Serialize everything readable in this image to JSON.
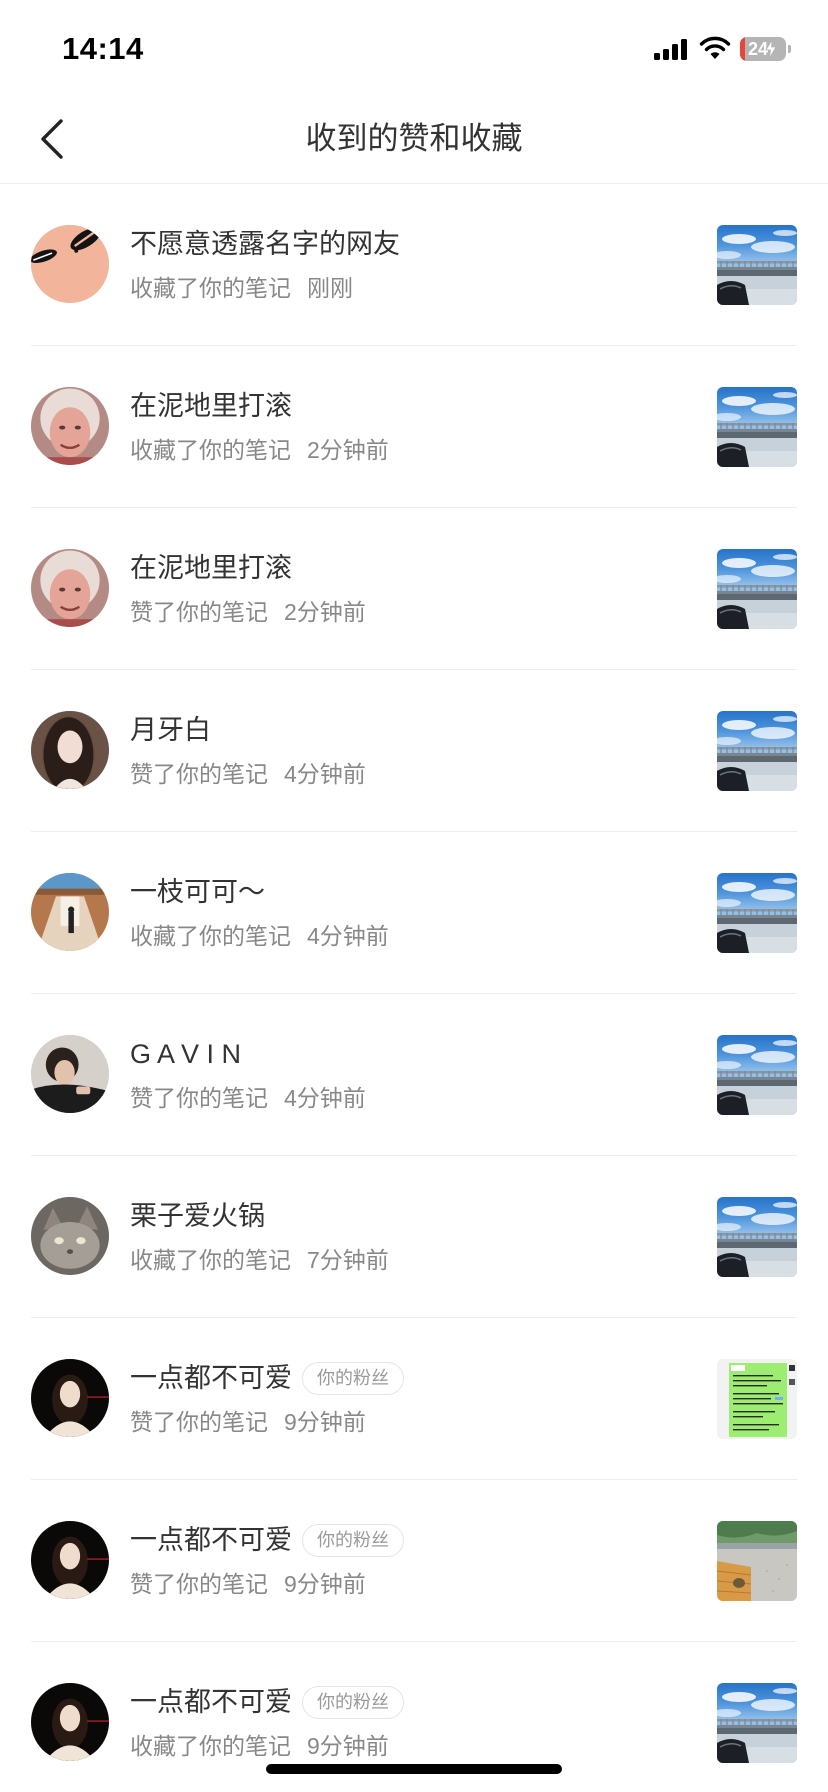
{
  "status_bar": {
    "time": "14:14",
    "battery": "24",
    "icons": [
      "cellular-signal-icon",
      "wifi-icon",
      "battery-icon",
      "charging-bolt-icon"
    ]
  },
  "header": {
    "title": "收到的赞和收藏",
    "back_icon": "chevron-left-icon"
  },
  "rows": [
    {
      "name": "不愿意透露名字的网友",
      "action": "收藏了你的笔记",
      "time": "刚刚",
      "avatar": "peach-abstract-avatar",
      "thumbnail": "bridge-sky-photo"
    },
    {
      "name": "在泥地里打滚",
      "action": "收藏了你的笔记",
      "time": "2分钟前",
      "avatar": "elderly-woman-avatar",
      "thumbnail": "bridge-sky-photo"
    },
    {
      "name": "在泥地里打滚",
      "action": "赞了你的笔记",
      "time": "2分钟前",
      "avatar": "elderly-woman-avatar",
      "thumbnail": "bridge-sky-photo"
    },
    {
      "name": "月牙白",
      "action": "赞了你的笔记",
      "time": "4分钟前",
      "avatar": "long-hair-girl-avatar",
      "thumbnail": "bridge-sky-photo"
    },
    {
      "name": "一枝可可～",
      "action": "收藏了你的笔记",
      "time": "4分钟前",
      "avatar": "corridor-scene-avatar",
      "thumbnail": "bridge-sky-photo"
    },
    {
      "name": "G A V I N",
      "action": "赞了你的笔记",
      "time": "4分钟前",
      "avatar": "young-man-avatar",
      "thumbnail": "bridge-sky-photo"
    },
    {
      "name": "栗子爱火锅",
      "action": "收藏了你的笔记",
      "time": "7分钟前",
      "avatar": "gray-cat-avatar",
      "thumbnail": "bridge-sky-photo"
    },
    {
      "name": "一点都不可爱",
      "badge": "你的粉丝",
      "action": "赞了你的笔记",
      "time": "9分钟前",
      "avatar": "dark-portrait-avatar",
      "thumbnail": "green-chat-screenshot"
    },
    {
      "name": "一点都不可爱",
      "badge": "你的粉丝",
      "action": "赞了你的笔记",
      "time": "9分钟前",
      "avatar": "dark-portrait-avatar",
      "thumbnail": "outdoor-table-photo"
    },
    {
      "name": "一点都不可爱",
      "badge": "你的粉丝",
      "action": "收藏了你的笔记",
      "time": "9分钟前",
      "avatar": "dark-portrait-avatar",
      "thumbnail": "bridge-sky-photo"
    }
  ],
  "colors": {
    "text_primary": "#333333",
    "text_secondary": "#888888",
    "badge_text": "#9a9a9a",
    "divider": "#ececec",
    "battery_low": "#e5473a"
  }
}
